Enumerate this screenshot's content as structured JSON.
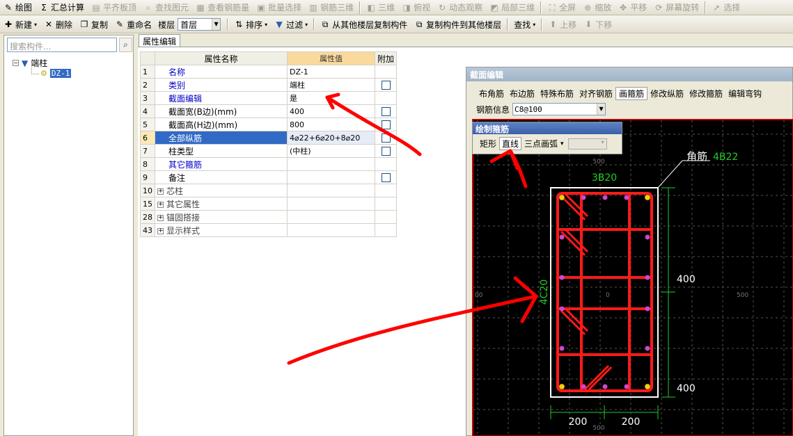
{
  "toolbar1": {
    "items": [
      {
        "label": "绘图",
        "icon": "drawing-icon",
        "enabled": true
      },
      {
        "label": "汇总计算",
        "icon": "sum-icon",
        "enabled": true
      },
      {
        "label": "平齐板顶",
        "icon": "flatten-icon",
        "enabled": false
      },
      {
        "label": "查找图元",
        "icon": "find-element-icon",
        "enabled": false
      },
      {
        "label": "查看钢筋量",
        "icon": "view-rebar-icon",
        "enabled": false
      },
      {
        "label": "批量选择",
        "icon": "batch-select-icon",
        "enabled": false
      },
      {
        "label": "钢筋三维",
        "icon": "rebar-3d-icon",
        "enabled": false
      },
      {
        "label": "三维",
        "icon": "3d-icon",
        "enabled": false
      },
      {
        "label": "俯视",
        "icon": "top-view-icon",
        "enabled": false
      },
      {
        "label": "动态观察",
        "icon": "orbit-icon",
        "enabled": false
      },
      {
        "label": "局部三维",
        "icon": "local-3d-icon",
        "enabled": false
      },
      {
        "label": "全屏",
        "icon": "fullscreen-icon",
        "enabled": false
      },
      {
        "label": "缩放",
        "icon": "zoom-icon",
        "enabled": false
      },
      {
        "label": "平移",
        "icon": "pan-icon",
        "enabled": false
      },
      {
        "label": "屏幕旋转",
        "icon": "rotate-icon",
        "enabled": false
      },
      {
        "label": "选择",
        "icon": "select-icon",
        "enabled": false
      }
    ]
  },
  "toolbar2": {
    "new_label": "新建",
    "delete_label": "删除",
    "copy_label": "复制",
    "rename_label": "重命名",
    "floor_label": "楼层",
    "floor_value": "首层",
    "sort_label": "排序",
    "filter_label": "过滤",
    "copy_from_label": "从其他楼层复制构件",
    "copy_to_label": "复制构件到其他楼层",
    "find_label": "查找",
    "up_label": "上移",
    "down_label": "下移"
  },
  "left_panel": {
    "search_placeholder": "搜索构件...",
    "tree_root": "端柱",
    "tree_child": "DZ-1"
  },
  "prop_tab": "属性编辑",
  "prop_table": {
    "headers": {
      "name": "属性名称",
      "value": "属性值",
      "extra": "附加"
    },
    "rows": [
      {
        "no": "1",
        "name": "名称",
        "value": "DZ-1",
        "blue": true,
        "check": false,
        "expand": false
      },
      {
        "no": "2",
        "name": "类别",
        "value": "端柱",
        "blue": true,
        "check": true,
        "expand": false
      },
      {
        "no": "3",
        "name": "截面编辑",
        "value": "是",
        "blue": true,
        "check": false,
        "expand": false
      },
      {
        "no": "4",
        "name": "截面宽(B边)(mm)",
        "value": "400",
        "blue": false,
        "check": true,
        "expand": false
      },
      {
        "no": "5",
        "name": "截面高(H边)(mm)",
        "value": "800",
        "blue": false,
        "check": true,
        "expand": false
      },
      {
        "no": "6",
        "name": "全部纵筋",
        "value": "4⌀22+6⌀20+8⌀20",
        "blue": false,
        "check": true,
        "expand": false,
        "selected": true
      },
      {
        "no": "7",
        "name": "柱类型",
        "value": "(中柱)",
        "blue": false,
        "check": true,
        "expand": false
      },
      {
        "no": "8",
        "name": "其它箍筋",
        "value": "",
        "blue": true,
        "check": false,
        "expand": false
      },
      {
        "no": "9",
        "name": "备注",
        "value": "",
        "blue": false,
        "check": true,
        "expand": false
      },
      {
        "no": "10",
        "name": "芯柱",
        "value": "",
        "blue": false,
        "check": false,
        "expand": true
      },
      {
        "no": "15",
        "name": "其它属性",
        "value": "",
        "blue": false,
        "check": false,
        "expand": true
      },
      {
        "no": "28",
        "name": "锚固搭接",
        "value": "",
        "blue": false,
        "check": false,
        "expand": true
      },
      {
        "no": "43",
        "name": "显示样式",
        "value": "",
        "blue": false,
        "check": false,
        "expand": true
      }
    ]
  },
  "section_editor": {
    "title": "截面编辑",
    "tools": [
      "布角筋",
      "布边筋",
      "特殊布筋",
      "对齐钢筋",
      "画箍筋",
      "修改纵筋",
      "修改箍筋",
      "编辑弯钩"
    ],
    "active_tool": "画箍筋",
    "rebar_info_label": "钢筋信息",
    "rebar_info_value": "C8@100"
  },
  "draw_stirrup_panel": {
    "title": "绘制箍筋",
    "options": [
      "矩形",
      "直线",
      "三点画弧"
    ],
    "active_option": "直线"
  },
  "drawing": {
    "corner_label": "角筋",
    "corner_value": "4B22",
    "top_label": "3B20",
    "side_label": "4C20",
    "dim_right_top": "400",
    "dim_right_bottom": "400",
    "dim_bottom_left": "200",
    "dim_bottom_right": "200",
    "axis_500": "500",
    "axis_0": "0",
    "axis_00": "00",
    "colors": {
      "background": "#000000",
      "rebar": "#ff1a1a",
      "dimension": "#22cc22",
      "outline": "#ffffff",
      "grid": "#555555",
      "corner_bar": "#f5d000",
      "side_bar": "#d046d0"
    }
  },
  "annotations": {
    "color": "#ff0000"
  }
}
